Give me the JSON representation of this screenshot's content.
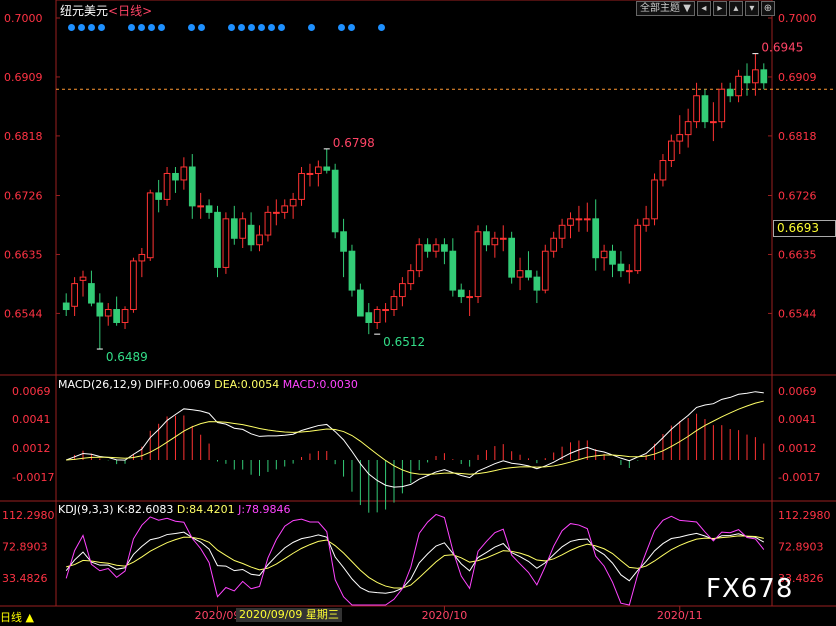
{
  "header": {
    "symbol": "纽元美元",
    "period_tag": "<日线>",
    "all_themes": "全部主题",
    "dropdown_icon": "▼",
    "nav_icons": [
      "◂",
      "▸",
      "▴",
      "▾",
      "⊕"
    ]
  },
  "colors": {
    "up": "#ff3333",
    "down": "#33cc77",
    "dif": "#ffffff",
    "dea": "#ffff66",
    "j": "#ff44ff",
    "axis_price": "#ff3344",
    "dots": "#1e90ff",
    "ref_line": "#ff9933"
  },
  "macd_indicator": {
    "name": "MACD(26,12,9)",
    "dif_label": "DIFF:0.0069",
    "dea_label": "DEA:0.0054",
    "macd_label": "MACD:0.0030"
  },
  "kdj_indicator": {
    "name": "KDJ(9,3,3)",
    "k_label": "K:82.6083",
    "d_label": "D:84.4201",
    "j_label": "J:78.9846"
  },
  "footer": {
    "period_button": "日线 ▲",
    "crosshair_date": "2020/09/09 星期三",
    "watermark": "FX678"
  },
  "current_price": "0.6693",
  "chart_data": {
    "type": "candlestick",
    "price_axis": {
      "ticks": [
        0.7,
        0.6909,
        0.6818,
        0.6726,
        0.6635,
        0.6544
      ],
      "tick_labels": [
        "0.7000",
        "0.6909",
        "0.6818",
        "0.6726",
        "0.6635",
        "0.6544"
      ],
      "ylim": [
        0.6469,
        0.7
      ],
      "reference_line": 0.689
    },
    "x_labels": [
      {
        "label": "2020/09",
        "index": 18
      },
      {
        "label": "2020/10",
        "index": 45
      },
      {
        "label": "2020/11",
        "index": 73
      }
    ],
    "dot_groups": [
      4,
      4,
      2,
      6,
      1,
      2,
      1
    ],
    "annotations": [
      {
        "label": "0.6489",
        "index": 4,
        "value": 0.6489,
        "kind": "low"
      },
      {
        "label": "0.6798",
        "index": 31,
        "value": 0.6798,
        "kind": "high"
      },
      {
        "label": "0.6512",
        "index": 37,
        "value": 0.6512,
        "kind": "low"
      },
      {
        "label": "0.6945",
        "index": 82,
        "value": 0.6945,
        "kind": "high"
      }
    ],
    "ohlc": [
      [
        0.656,
        0.6575,
        0.654,
        0.655
      ],
      [
        0.6555,
        0.66,
        0.654,
        0.659
      ],
      [
        0.6595,
        0.661,
        0.657,
        0.66
      ],
      [
        0.659,
        0.661,
        0.6555,
        0.656
      ],
      [
        0.656,
        0.6575,
        0.6489,
        0.654
      ],
      [
        0.654,
        0.656,
        0.6525,
        0.655
      ],
      [
        0.655,
        0.657,
        0.6525,
        0.653
      ],
      [
        0.653,
        0.6555,
        0.652,
        0.655
      ],
      [
        0.655,
        0.663,
        0.6545,
        0.6625
      ],
      [
        0.6625,
        0.6645,
        0.66,
        0.6635
      ],
      [
        0.663,
        0.6735,
        0.6625,
        0.673
      ],
      [
        0.673,
        0.675,
        0.67,
        0.672
      ],
      [
        0.672,
        0.677,
        0.671,
        0.676
      ],
      [
        0.676,
        0.677,
        0.673,
        0.675
      ],
      [
        0.675,
        0.6785,
        0.6735,
        0.677
      ],
      [
        0.677,
        0.679,
        0.669,
        0.671
      ],
      [
        0.671,
        0.673,
        0.669,
        0.671
      ],
      [
        0.671,
        0.672,
        0.669,
        0.67
      ],
      [
        0.67,
        0.671,
        0.66,
        0.6615
      ],
      [
        0.6615,
        0.67,
        0.6605,
        0.669
      ],
      [
        0.669,
        0.671,
        0.665,
        0.666
      ],
      [
        0.666,
        0.67,
        0.6645,
        0.669
      ],
      [
        0.668,
        0.67,
        0.664,
        0.665
      ],
      [
        0.665,
        0.668,
        0.664,
        0.6665
      ],
      [
        0.6665,
        0.671,
        0.6655,
        0.67
      ],
      [
        0.67,
        0.672,
        0.668,
        0.67
      ],
      [
        0.67,
        0.672,
        0.669,
        0.671
      ],
      [
        0.671,
        0.673,
        0.669,
        0.672
      ],
      [
        0.672,
        0.677,
        0.671,
        0.676
      ],
      [
        0.676,
        0.6775,
        0.674,
        0.676
      ],
      [
        0.676,
        0.678,
        0.674,
        0.677
      ],
      [
        0.677,
        0.6798,
        0.676,
        0.6765
      ],
      [
        0.6765,
        0.6775,
        0.666,
        0.667
      ],
      [
        0.667,
        0.669,
        0.66,
        0.664
      ],
      [
        0.664,
        0.665,
        0.657,
        0.658
      ],
      [
        0.658,
        0.659,
        0.654,
        0.654
      ],
      [
        0.6545,
        0.656,
        0.6512,
        0.653
      ],
      [
        0.653,
        0.6555,
        0.652,
        0.655
      ],
      [
        0.655,
        0.656,
        0.653,
        0.655
      ],
      [
        0.655,
        0.658,
        0.654,
        0.657
      ],
      [
        0.657,
        0.66,
        0.6555,
        0.659
      ],
      [
        0.659,
        0.662,
        0.658,
        0.661
      ],
      [
        0.661,
        0.666,
        0.66,
        0.665
      ],
      [
        0.665,
        0.666,
        0.663,
        0.664
      ],
      [
        0.664,
        0.666,
        0.663,
        0.665
      ],
      [
        0.665,
        0.666,
        0.662,
        0.664
      ],
      [
        0.664,
        0.666,
        0.657,
        0.658
      ],
      [
        0.658,
        0.659,
        0.656,
        0.657
      ],
      [
        0.657,
        0.658,
        0.654,
        0.657
      ],
      [
        0.657,
        0.668,
        0.656,
        0.667
      ],
      [
        0.667,
        0.668,
        0.664,
        0.665
      ],
      [
        0.665,
        0.667,
        0.663,
        0.666
      ],
      [
        0.666,
        0.668,
        0.664,
        0.666
      ],
      [
        0.666,
        0.667,
        0.659,
        0.66
      ],
      [
        0.66,
        0.663,
        0.658,
        0.661
      ],
      [
        0.661,
        0.664,
        0.6595,
        0.66
      ],
      [
        0.66,
        0.661,
        0.656,
        0.658
      ],
      [
        0.658,
        0.665,
        0.6575,
        0.664
      ],
      [
        0.664,
        0.667,
        0.663,
        0.666
      ],
      [
        0.666,
        0.669,
        0.6645,
        0.668
      ],
      [
        0.668,
        0.67,
        0.666,
        0.669
      ],
      [
        0.669,
        0.671,
        0.667,
        0.669
      ],
      [
        0.669,
        0.6715,
        0.667,
        0.669
      ],
      [
        0.669,
        0.672,
        0.661,
        0.663
      ],
      [
        0.663,
        0.665,
        0.661,
        0.664
      ],
      [
        0.664,
        0.665,
        0.66,
        0.662
      ],
      [
        0.662,
        0.664,
        0.66,
        0.661
      ],
      [
        0.661,
        0.662,
        0.659,
        0.661
      ],
      [
        0.661,
        0.669,
        0.6605,
        0.668
      ],
      [
        0.668,
        0.671,
        0.667,
        0.669
      ],
      [
        0.669,
        0.676,
        0.668,
        0.675
      ],
      [
        0.675,
        0.679,
        0.674,
        0.678
      ],
      [
        0.678,
        0.682,
        0.677,
        0.681
      ],
      [
        0.681,
        0.685,
        0.679,
        0.682
      ],
      [
        0.682,
        0.686,
        0.68,
        0.684
      ],
      [
        0.684,
        0.69,
        0.683,
        0.688
      ],
      [
        0.688,
        0.689,
        0.683,
        0.684
      ],
      [
        0.684,
        0.687,
        0.681,
        0.684
      ],
      [
        0.684,
        0.69,
        0.683,
        0.689
      ],
      [
        0.689,
        0.69,
        0.687,
        0.688
      ],
      [
        0.688,
        0.692,
        0.687,
        0.691
      ],
      [
        0.691,
        0.693,
        0.688,
        0.69
      ],
      [
        0.69,
        0.6945,
        0.688,
        0.692
      ],
      [
        0.692,
        0.693,
        0.689,
        0.69
      ]
    ],
    "macd": {
      "axis_ticks": [
        0.0069,
        0.0041,
        0.0012,
        -0.0017
      ],
      "tick_labels": [
        "0.0069",
        "0.0041",
        "0.0012",
        "-0.0017"
      ],
      "ylim": [
        -0.004,
        0.008
      ]
    },
    "kdj": {
      "axis_ticks": [
        112.298,
        72.8903,
        33.4826
      ],
      "tick_labels": [
        "112.2980",
        "72.8903",
        "33.4826"
      ],
      "ylim": [
        0,
        125
      ]
    }
  }
}
